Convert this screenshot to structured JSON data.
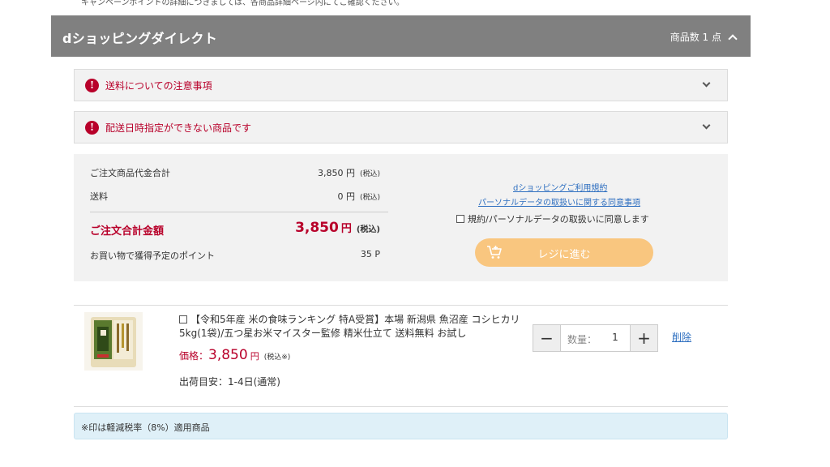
{
  "top_note": "キャンペーンポイントの詳細につきましては、各商品詳細ページ内にてご確認ください。",
  "shop": {
    "name": "dショッピングダイレクト",
    "item_count": "商品数 1 点"
  },
  "notices": [
    {
      "label": "送料についての注意事項"
    },
    {
      "label": "配送日時指定ができない商品です"
    }
  ],
  "summary": {
    "subtotal_label": "ご注文商品代金合計",
    "subtotal_value": "3,850 円",
    "shipping_label": "送料",
    "shipping_value": "0 円",
    "tax_label": "(税込)",
    "total_label": "ご注文合計金額",
    "total_value": "3,850",
    "total_unit": "円",
    "points_label": "お買い物で獲得予定のポイント",
    "points_value": "35 P"
  },
  "terms": {
    "link1": "dショッピングご利用規約",
    "link2": "パーソナルデータの取扱いに関する同意事項",
    "agree_label": "規約/パーソナルデータの取扱いに同意します"
  },
  "checkout": {
    "label": "レジに進む"
  },
  "item": {
    "title": "【令和5年産 米の食味ランキング 特A受賞】本場 新潟県 魚沼産 コシヒカリ 5kg(1袋)/五つ星お米マイスター監修 精米仕立て 送料無料 お試し",
    "price_label": "価格：",
    "price_value": "3,850",
    "price_unit": "円",
    "price_tax": "(税込※)",
    "ship_estimate": "出荷目安：1-4日(通常)",
    "qty_label": "数量：",
    "qty_value": "1",
    "minus": "−",
    "plus": "+",
    "delete_label": "削除"
  },
  "tax_note": "※印は軽減税率（8%）適用商品",
  "colors": {
    "header_bg": "#808080",
    "accent_red": "#b8002a",
    "link_blue": "#2e6fc0",
    "checkout_orange": "#f9c67f",
    "note_bg": "#dff0f8"
  }
}
